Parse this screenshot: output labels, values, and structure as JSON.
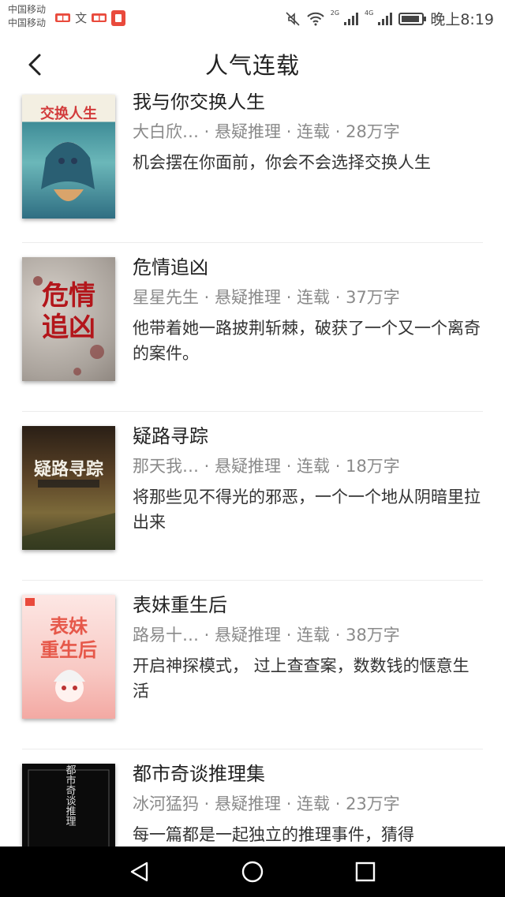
{
  "status": {
    "carrier1": "中国移动",
    "carrier2": "中国移动",
    "time": "晚上8:19",
    "net1": "2G",
    "net2": "4G"
  },
  "header": {
    "title": "人气连载"
  },
  "books": [
    {
      "title": "我与你交换人生",
      "meta": "大白欣…  · 悬疑推理 · 连载 · 28万字",
      "desc": "机会摆在你面前，你会不会选择交换人生",
      "cover_text": "交换人生"
    },
    {
      "title": "危情追凶",
      "meta": "星星先生 · 悬疑推理 · 连载 · 37万字",
      "desc": "他带着她一路披荆斩棘，破获了一个又一个离奇的案件。",
      "cover_text": "危情追凶"
    },
    {
      "title": "疑路寻踪",
      "meta": "那天我…  · 悬疑推理 · 连载 · 18万字",
      "desc": "将那些见不得光的邪恶，一个一个地从阴暗里拉出来",
      "cover_text": "疑路寻踪"
    },
    {
      "title": "表妹重生后",
      "meta": "路易十…  · 悬疑推理 · 连载 · 38万字",
      "desc": "开启神探模式， 过上查查案，数数钱的惬意生活",
      "cover_text": "表妹重生后"
    },
    {
      "title": "都市奇谈推理集",
      "meta": "冰河猛犸 · 悬疑推理 · 连载 · 23万字",
      "desc": "每一篇都是一起独立的推理事件，猜得",
      "cover_text": "都市奇谈推理集"
    }
  ]
}
